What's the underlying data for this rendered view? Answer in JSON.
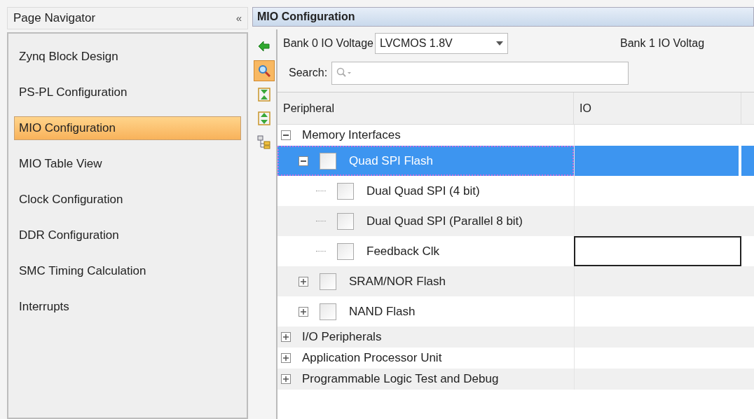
{
  "navigator": {
    "title": "Page Navigator",
    "collapse_glyph": "«",
    "items": [
      {
        "label": "Zynq Block Design",
        "selected": false
      },
      {
        "label": "PS-PL Configuration",
        "selected": false
      },
      {
        "label": "MIO Configuration",
        "selected": true
      },
      {
        "label": "MIO Table View",
        "selected": false
      },
      {
        "label": "Clock Configuration",
        "selected": false
      },
      {
        "label": "DDR Configuration",
        "selected": false
      },
      {
        "label": "SMC Timing Calculation",
        "selected": false
      },
      {
        "label": "Interrupts",
        "selected": false
      }
    ]
  },
  "panel": {
    "title": "MIO Configuration",
    "toolbar": [
      {
        "kind": "back",
        "selected": false
      },
      {
        "kind": "search",
        "selected": true
      },
      {
        "kind": "collapse",
        "selected": false
      },
      {
        "kind": "expand",
        "selected": false
      },
      {
        "kind": "hierarchy",
        "selected": false
      }
    ],
    "bank0": {
      "label": "Bank 0 IO Voltage",
      "value": "LVCMOS 1.8V"
    },
    "bank1": {
      "label": "Bank 1 IO Voltag"
    },
    "search": {
      "label": "Search:"
    },
    "table": {
      "columns": [
        "Peripheral",
        "IO"
      ],
      "rows": [
        {
          "label": "Memory Interfaces",
          "kind": "group",
          "expanded": true,
          "selected": false,
          "children": [
            {
              "label": "Quad SPI Flash",
              "kind": "option",
              "expanded": true,
              "checked": false,
              "selected": true,
              "children": [
                {
                  "label": "Dual Quad SPI (4 bit)",
                  "kind": "option",
                  "checked": false,
                  "selected": false
                },
                {
                  "label": "Dual Quad SPI (Parallel 8 bit)",
                  "kind": "option",
                  "checked": false,
                  "selected": false
                },
                {
                  "label": "Feedback Clk",
                  "kind": "option",
                  "checked": false,
                  "selected": false,
                  "io_editing": true
                }
              ]
            },
            {
              "label": "SRAM/NOR Flash",
              "kind": "option",
              "expanded": false,
              "checked": false,
              "selected": false
            },
            {
              "label": "NAND Flash",
              "kind": "option",
              "expanded": false,
              "checked": false,
              "selected": false
            }
          ]
        },
        {
          "label": "I/O Peripherals",
          "kind": "group",
          "expanded": false,
          "selected": false
        },
        {
          "label": "Application Processor Unit",
          "kind": "group",
          "expanded": false,
          "selected": false
        },
        {
          "label": "Programmable Logic Test and Debug",
          "kind": "group",
          "expanded": false,
          "selected": false
        }
      ]
    }
  }
}
